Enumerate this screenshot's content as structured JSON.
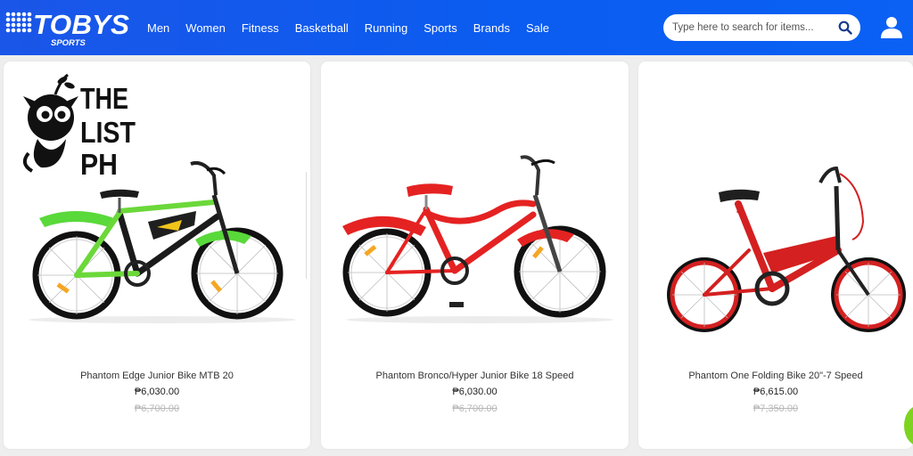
{
  "brand": {
    "name": "TOBYS",
    "sub": "SPORTS"
  },
  "nav": {
    "items": [
      "Men",
      "Women",
      "Fitness",
      "Basketball",
      "Running",
      "Sports",
      "Brands",
      "Sale"
    ]
  },
  "search": {
    "placeholder": "Type here to search for items..."
  },
  "watermark": {
    "lines": [
      "THE",
      "LIST",
      "PH"
    ]
  },
  "products": [
    {
      "name": "Phantom Edge Junior Bike MTB 20",
      "price": "₱6,030.00",
      "old_price": "₱6,700.00"
    },
    {
      "name": "Phantom Bronco/Hyper Junior Bike 18 Speed",
      "price": "₱6,030.00",
      "old_price": "₱6,700.00"
    },
    {
      "name": "Phantom One Folding Bike 20\"-7 Speed",
      "price": "₱6,615.00",
      "old_price": "₱7,350.00"
    }
  ],
  "colors": {
    "header": "#0b5cf0",
    "accent_green": "#7ed321",
    "bike_red": "#e52222",
    "bike_green": "#5ee23a"
  }
}
